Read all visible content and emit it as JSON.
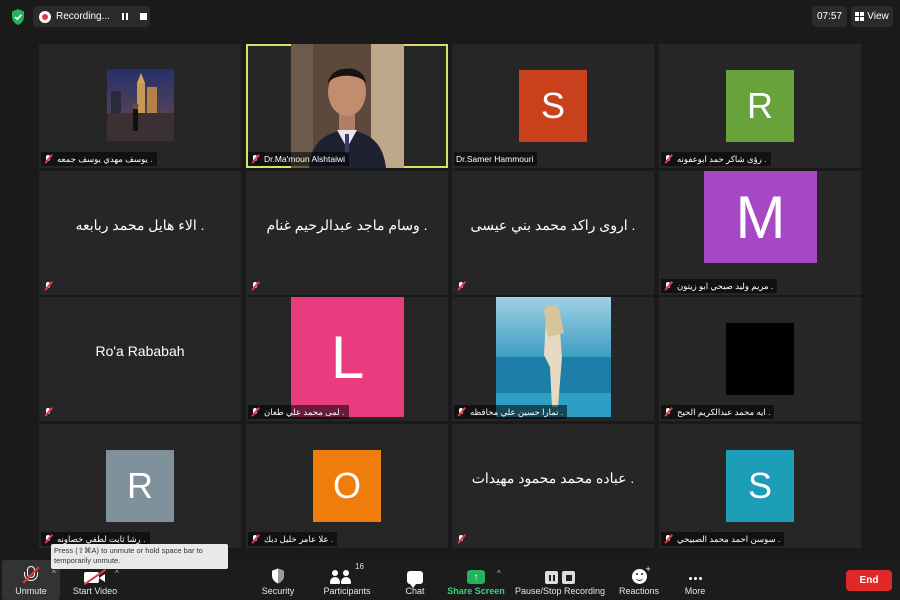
{
  "topbar": {
    "recording_label": "Recording...",
    "time": "07:57",
    "view_label": "View"
  },
  "tiles": [
    {
      "name": "يوسف مهدي يوسف جمعه .",
      "center_text": "",
      "avatar": "photo-city",
      "avatar_letter": "",
      "avatar_color": "",
      "active": false
    },
    {
      "name": "Dr.Ma'moun Alshtaiwi",
      "center_text": "",
      "avatar": "photo-person",
      "avatar_letter": "",
      "avatar_color": "",
      "active": true
    },
    {
      "name": "Dr.Samer Hammouri",
      "center_text": "",
      "avatar": "letter",
      "avatar_letter": "S",
      "avatar_color": "#c8401c",
      "active": false,
      "no_mic": true
    },
    {
      "name": "رؤى شاكر حمد ابوعفونه .",
      "center_text": "",
      "avatar": "letter",
      "avatar_letter": "R",
      "avatar_color": "#67a23a",
      "active": false
    },
    {
      "name": "",
      "center_text": "الاء هايل محمد ربابعه .",
      "avatar": "none",
      "avatar_letter": "",
      "avatar_color": "",
      "active": false
    },
    {
      "name": "",
      "center_text": "وسام ماجد عبدالرحيم غنام .",
      "avatar": "none",
      "avatar_letter": "",
      "avatar_color": "",
      "active": false
    },
    {
      "name": "",
      "center_text": "اروى راكد محمد بني عيسى .",
      "avatar": "none",
      "avatar_letter": "",
      "avatar_color": "",
      "active": false
    },
    {
      "name": "مريم وليد صبحي ابو زيتون .",
      "center_text": "",
      "avatar": "letter",
      "avatar_letter": "M",
      "avatar_color": "#a647c6",
      "active": false
    },
    {
      "name": "",
      "center_text": "Ro'a Rababah",
      "avatar": "none",
      "avatar_letter": "",
      "avatar_color": "",
      "active": false
    },
    {
      "name": "لمى محمد علي طعان .",
      "center_text": "",
      "avatar": "letter",
      "avatar_letter": "L",
      "avatar_color": "#e83c7e",
      "active": false
    },
    {
      "name": "تمارا حسين علي محافظه .",
      "center_text": "",
      "avatar": "photo-sea",
      "avatar_letter": "",
      "avatar_color": "",
      "active": false
    },
    {
      "name": "ايه محمد عبدالكريم الحيح .",
      "center_text": "",
      "avatar": "letter",
      "avatar_letter": "",
      "avatar_color": "#000000",
      "active": false
    },
    {
      "name": "رشا ثابت لطفي خصاونه .",
      "center_text": "",
      "avatar": "letter",
      "avatar_letter": "R",
      "avatar_color": "#7f919b",
      "active": false
    },
    {
      "name": "علا عامر خليل دبك .",
      "center_text": "",
      "avatar": "letter",
      "avatar_letter": "O",
      "avatar_color": "#ef7d0c",
      "active": false
    },
    {
      "name": "",
      "center_text": "عباده محمد محمود مهيدات .",
      "avatar": "none",
      "avatar_letter": "",
      "avatar_color": "",
      "active": false
    },
    {
      "name": "سوسن احمد محمد الصبيحي .",
      "center_text": "",
      "avatar": "letter",
      "avatar_letter": "S",
      "avatar_color": "#1c9db8",
      "active": false
    }
  ],
  "tooltip": "Press (⇧⌘A) to unmute or hold space bar to temporarily unmute.",
  "toolbar": {
    "unmute": "Unmute",
    "start_video": "Start Video",
    "security": "Security",
    "participants": "Participants",
    "participants_count": "16",
    "chat": "Chat",
    "share_screen": "Share Screen",
    "pause_stop_recording": "Pause/Stop Recording",
    "reactions": "Reactions",
    "more": "More",
    "end": "End"
  },
  "colors": {
    "active_border": "#d7e06a",
    "share_green": "#23b35a",
    "end_red": "#e02828",
    "muted_red": "#e0394a"
  }
}
